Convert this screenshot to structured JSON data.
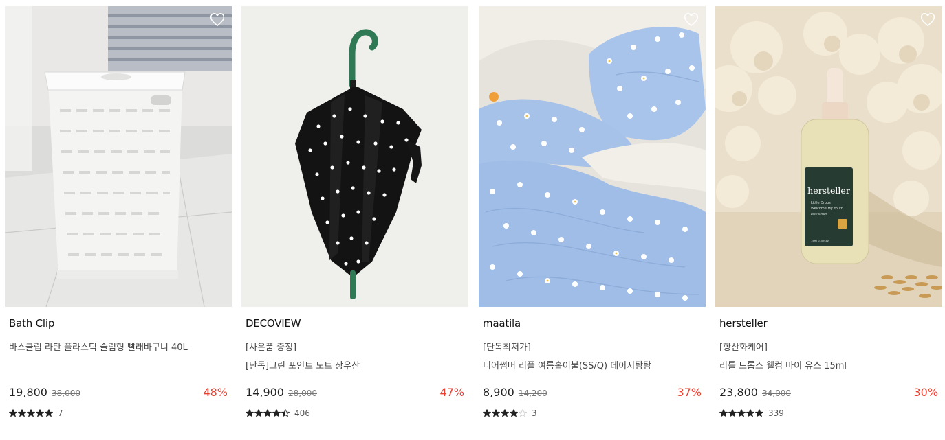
{
  "products": [
    {
      "brand": "Bath Clip",
      "tag": "",
      "name": "바스클립 라탄 플라스틱 슬림형 빨래바구니 40L",
      "price": "19,800",
      "original_price": "38,000",
      "discount": "48%",
      "rating": 5,
      "review_count": "7",
      "image_icon": "laundry-basket"
    },
    {
      "brand": "DECOVIEW",
      "tag": "[사은품 증정]",
      "name": "[단독]그린 포인트 도트 장우산",
      "price": "14,900",
      "original_price": "28,000",
      "discount": "47%",
      "rating": 4.5,
      "review_count": "406",
      "image_icon": "umbrella"
    },
    {
      "brand": "maatila",
      "tag": "[단독최저가]",
      "name": "디어썸머 리플 여름홑이불(SS/Q) 데이지탐탐",
      "price": "8,900",
      "original_price": "14,200",
      "discount": "37%",
      "rating": 4,
      "review_count": "3",
      "image_icon": "bedding"
    },
    {
      "brand": "hersteller",
      "tag": "[항산화케어]",
      "name": "리틀 드롭스 웰컴 마이 유스 15ml",
      "price": "23,800",
      "original_price": "34,000",
      "discount": "30%",
      "rating": 5,
      "review_count": "339",
      "image_icon": "serum-bottle",
      "bottle_label": {
        "brand": "hersteller",
        "line1": "Little Drops",
        "line2": "Welcome My Youth",
        "line3": "Face Serum",
        "volume": "15ml 0.50fl.oz."
      }
    }
  ],
  "colors": {
    "discount": "#ea3e2f",
    "star": "#222222",
    "star_empty": "#cccccc"
  }
}
